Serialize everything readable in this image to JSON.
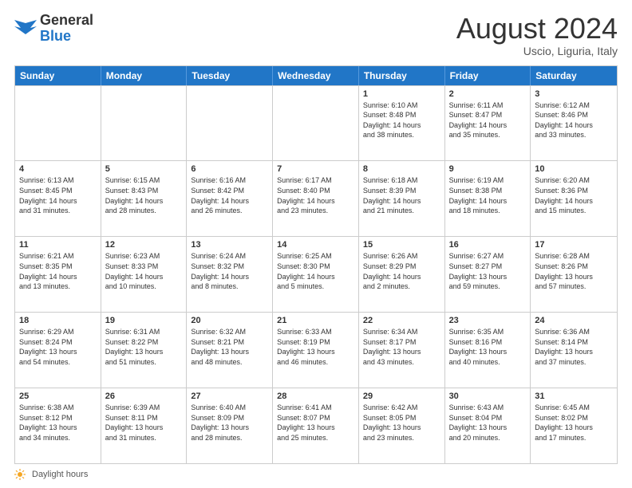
{
  "header": {
    "logo_line1": "General",
    "logo_line2": "Blue",
    "month_year": "August 2024",
    "location": "Uscio, Liguria, Italy"
  },
  "calendar": {
    "days_of_week": [
      "Sunday",
      "Monday",
      "Tuesday",
      "Wednesday",
      "Thursday",
      "Friday",
      "Saturday"
    ],
    "rows": [
      [
        {
          "day": "",
          "info": ""
        },
        {
          "day": "",
          "info": ""
        },
        {
          "day": "",
          "info": ""
        },
        {
          "day": "",
          "info": ""
        },
        {
          "day": "1",
          "info": "Sunrise: 6:10 AM\nSunset: 8:48 PM\nDaylight: 14 hours\nand 38 minutes."
        },
        {
          "day": "2",
          "info": "Sunrise: 6:11 AM\nSunset: 8:47 PM\nDaylight: 14 hours\nand 35 minutes."
        },
        {
          "day": "3",
          "info": "Sunrise: 6:12 AM\nSunset: 8:46 PM\nDaylight: 14 hours\nand 33 minutes."
        }
      ],
      [
        {
          "day": "4",
          "info": "Sunrise: 6:13 AM\nSunset: 8:45 PM\nDaylight: 14 hours\nand 31 minutes."
        },
        {
          "day": "5",
          "info": "Sunrise: 6:15 AM\nSunset: 8:43 PM\nDaylight: 14 hours\nand 28 minutes."
        },
        {
          "day": "6",
          "info": "Sunrise: 6:16 AM\nSunset: 8:42 PM\nDaylight: 14 hours\nand 26 minutes."
        },
        {
          "day": "7",
          "info": "Sunrise: 6:17 AM\nSunset: 8:40 PM\nDaylight: 14 hours\nand 23 minutes."
        },
        {
          "day": "8",
          "info": "Sunrise: 6:18 AM\nSunset: 8:39 PM\nDaylight: 14 hours\nand 21 minutes."
        },
        {
          "day": "9",
          "info": "Sunrise: 6:19 AM\nSunset: 8:38 PM\nDaylight: 14 hours\nand 18 minutes."
        },
        {
          "day": "10",
          "info": "Sunrise: 6:20 AM\nSunset: 8:36 PM\nDaylight: 14 hours\nand 15 minutes."
        }
      ],
      [
        {
          "day": "11",
          "info": "Sunrise: 6:21 AM\nSunset: 8:35 PM\nDaylight: 14 hours\nand 13 minutes."
        },
        {
          "day": "12",
          "info": "Sunrise: 6:23 AM\nSunset: 8:33 PM\nDaylight: 14 hours\nand 10 minutes."
        },
        {
          "day": "13",
          "info": "Sunrise: 6:24 AM\nSunset: 8:32 PM\nDaylight: 14 hours\nand 8 minutes."
        },
        {
          "day": "14",
          "info": "Sunrise: 6:25 AM\nSunset: 8:30 PM\nDaylight: 14 hours\nand 5 minutes."
        },
        {
          "day": "15",
          "info": "Sunrise: 6:26 AM\nSunset: 8:29 PM\nDaylight: 14 hours\nand 2 minutes."
        },
        {
          "day": "16",
          "info": "Sunrise: 6:27 AM\nSunset: 8:27 PM\nDaylight: 13 hours\nand 59 minutes."
        },
        {
          "day": "17",
          "info": "Sunrise: 6:28 AM\nSunset: 8:26 PM\nDaylight: 13 hours\nand 57 minutes."
        }
      ],
      [
        {
          "day": "18",
          "info": "Sunrise: 6:29 AM\nSunset: 8:24 PM\nDaylight: 13 hours\nand 54 minutes."
        },
        {
          "day": "19",
          "info": "Sunrise: 6:31 AM\nSunset: 8:22 PM\nDaylight: 13 hours\nand 51 minutes."
        },
        {
          "day": "20",
          "info": "Sunrise: 6:32 AM\nSunset: 8:21 PM\nDaylight: 13 hours\nand 48 minutes."
        },
        {
          "day": "21",
          "info": "Sunrise: 6:33 AM\nSunset: 8:19 PM\nDaylight: 13 hours\nand 46 minutes."
        },
        {
          "day": "22",
          "info": "Sunrise: 6:34 AM\nSunset: 8:17 PM\nDaylight: 13 hours\nand 43 minutes."
        },
        {
          "day": "23",
          "info": "Sunrise: 6:35 AM\nSunset: 8:16 PM\nDaylight: 13 hours\nand 40 minutes."
        },
        {
          "day": "24",
          "info": "Sunrise: 6:36 AM\nSunset: 8:14 PM\nDaylight: 13 hours\nand 37 minutes."
        }
      ],
      [
        {
          "day": "25",
          "info": "Sunrise: 6:38 AM\nSunset: 8:12 PM\nDaylight: 13 hours\nand 34 minutes."
        },
        {
          "day": "26",
          "info": "Sunrise: 6:39 AM\nSunset: 8:11 PM\nDaylight: 13 hours\nand 31 minutes."
        },
        {
          "day": "27",
          "info": "Sunrise: 6:40 AM\nSunset: 8:09 PM\nDaylight: 13 hours\nand 28 minutes."
        },
        {
          "day": "28",
          "info": "Sunrise: 6:41 AM\nSunset: 8:07 PM\nDaylight: 13 hours\nand 25 minutes."
        },
        {
          "day": "29",
          "info": "Sunrise: 6:42 AM\nSunset: 8:05 PM\nDaylight: 13 hours\nand 23 minutes."
        },
        {
          "day": "30",
          "info": "Sunrise: 6:43 AM\nSunset: 8:04 PM\nDaylight: 13 hours\nand 20 minutes."
        },
        {
          "day": "31",
          "info": "Sunrise: 6:45 AM\nSunset: 8:02 PM\nDaylight: 13 hours\nand 17 minutes."
        }
      ]
    ]
  },
  "footer": {
    "daylight_label": "Daylight hours"
  }
}
